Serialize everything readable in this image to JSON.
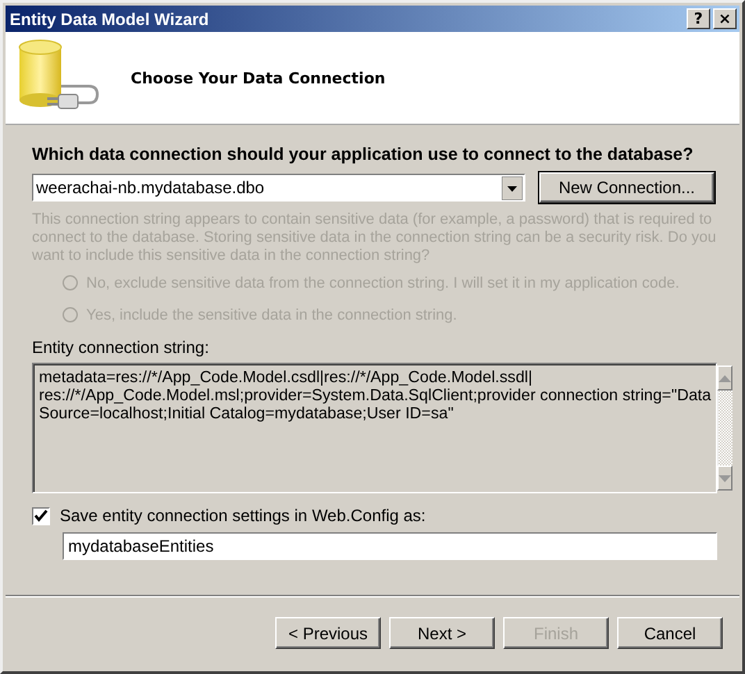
{
  "window": {
    "title": "Entity Data Model Wizard",
    "title_buttons": [
      "?",
      "×"
    ]
  },
  "header": {
    "title": "Choose Your Data Connection"
  },
  "question": "Which data connection should your application use to connect to the database?",
  "connection": {
    "value": "weerachai-nb.mydatabase.dbo",
    "button": "New Connection..."
  },
  "sensitive": {
    "disabled": true,
    "text": "This connection string appears to contain sensitive data (for example, a password) that is required to connect to the database. Storing sensitive data in the connection string can be a security risk. Do you want to include this sensitive data in the connection string?",
    "options": [
      {
        "label": "No, exclude sensitive data from the connection string. I will set it in my application code.",
        "selected": false,
        "disabled": true
      },
      {
        "label": "Yes, include the sensitive data in the connection string.",
        "selected": false,
        "disabled": true
      }
    ]
  },
  "entity_string": {
    "label": "Entity connection string:",
    "lines": [
      "metadata=res://*/App_Code.Model.csdl|res://*/App_Code.Model.ssdl|",
      "res://*/App_Code.Model.msl;provider=System.Data.SqlClient;provider connection string=\"Data",
      "Source=localhost;Initial Catalog=mydatabase;User ID=sa\""
    ]
  },
  "save": {
    "label": "Save entity connection settings in Web.Config as:",
    "checked": true,
    "value": "mydatabaseEntities"
  },
  "buttons": [
    {
      "label": "< Previous",
      "disabled": false
    },
    {
      "label": "Next >",
      "disabled": false
    },
    {
      "label": "Finish",
      "disabled": true
    },
    {
      "label": "Cancel",
      "disabled": false
    }
  ]
}
